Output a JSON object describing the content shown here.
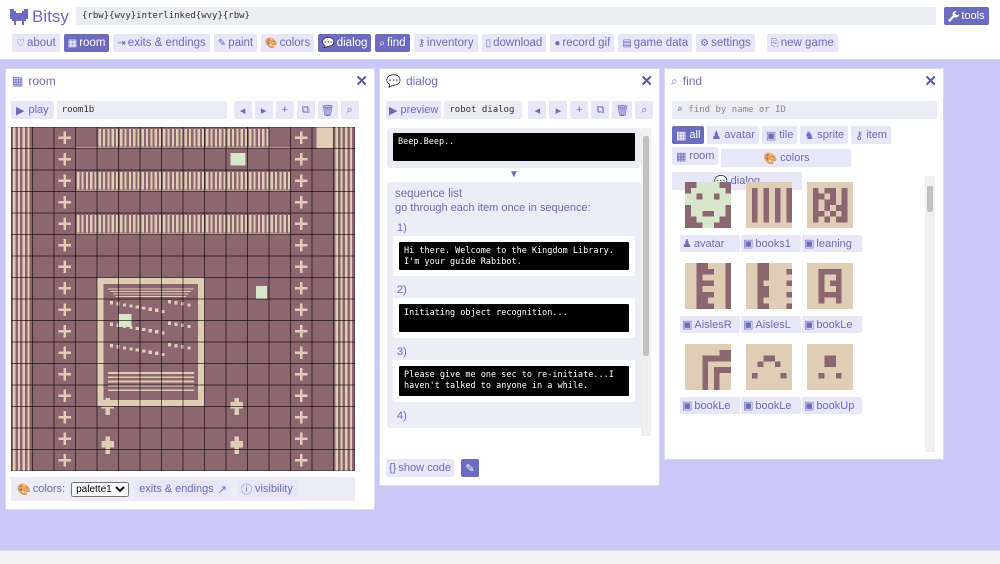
{
  "app": {
    "name": "Bitsy",
    "game_title": "{rbw}{wvy}interlinked{wvy}{rbw}",
    "tools_label": "tools"
  },
  "nav": [
    {
      "id": "about",
      "label": "about",
      "icon": "heart-icon",
      "active": false
    },
    {
      "id": "room",
      "label": "room",
      "icon": "grid-icon",
      "active": true
    },
    {
      "id": "exits",
      "label": "exits & endings",
      "icon": "exit-icon",
      "active": false
    },
    {
      "id": "paint",
      "label": "paint",
      "icon": "brush-icon",
      "active": false
    },
    {
      "id": "colors",
      "label": "colors",
      "icon": "palette-icon",
      "active": false
    },
    {
      "id": "dialog",
      "label": "dialog",
      "icon": "speech-icon",
      "active": true
    },
    {
      "id": "find",
      "label": "find",
      "icon": "search-icon",
      "active": true
    },
    {
      "id": "inventory",
      "label": "inventory",
      "icon": "key-icon",
      "active": false
    },
    {
      "id": "download",
      "label": "download",
      "icon": "file-icon",
      "active": false
    },
    {
      "id": "record",
      "label": "record gif",
      "icon": "record-icon",
      "active": false
    },
    {
      "id": "gamedata",
      "label": "game data",
      "icon": "data-icon",
      "active": false
    },
    {
      "id": "settings",
      "label": "settings",
      "icon": "gear-icon",
      "active": false
    },
    {
      "id": "newgame",
      "label": "new game",
      "icon": "new-file-icon",
      "active": false
    }
  ],
  "room_panel": {
    "title": "room",
    "play_label": "play",
    "room_name": "room1b",
    "colors_label": "colors:",
    "palette_value": "palette1",
    "exits_label": "exits & endings",
    "visibility_label": "visibility"
  },
  "dialog_panel": {
    "title": "dialog",
    "preview_label": "preview",
    "dialog_name": "robot dialog",
    "main_text": "Beep.Beep..",
    "sequence_title": "sequence list",
    "sequence_desc_prefix": "go through each item once in",
    "sequence_desc_link": "sequence:",
    "items": [
      {
        "num": "1)",
        "text": "Hi there. Welcome to the Kingdom Library. I'm your guide Rabibot."
      },
      {
        "num": "2)",
        "text": "Initiating object recognition..."
      },
      {
        "num": "3)",
        "text": "Please give me one sec to re-initiate...I haven't talked to anyone in a while."
      },
      {
        "num": "4)",
        "text": ""
      }
    ],
    "show_code_label": "show code"
  },
  "find_panel": {
    "title": "find",
    "search_placeholder": "find by name or ID",
    "filters": [
      {
        "label": "all",
        "icon": "grid-icon",
        "active": true
      },
      {
        "label": "avatar",
        "icon": "avatar-icon",
        "active": false
      },
      {
        "label": "tile",
        "icon": "tile-icon",
        "active": false
      },
      {
        "label": "sprite",
        "icon": "sprite-icon",
        "active": false
      },
      {
        "label": "item",
        "icon": "key-icon",
        "active": false
      },
      {
        "label": "room",
        "icon": "grid-icon",
        "active": false
      }
    ],
    "filters_row2": [
      {
        "label": "colors",
        "icon": "palette-icon"
      },
      {
        "label": "dialog",
        "icon": "speech-icon"
      }
    ],
    "tiles": [
      {
        "label": "avatar",
        "icon": "avatar-icon"
      },
      {
        "label": "books1",
        "icon": "tile-icon"
      },
      {
        "label": "leaning",
        "icon": "tile-icon"
      },
      {
        "label": "AislesR",
        "icon": "tile-icon"
      },
      {
        "label": "AislesL",
        "icon": "tile-icon"
      },
      {
        "label": "bookLe",
        "icon": "tile-icon"
      },
      {
        "label": "bookLe",
        "icon": "tile-icon"
      },
      {
        "label": "bookLe",
        "icon": "tile-icon"
      },
      {
        "label": "bookUp",
        "icon": "tile-icon"
      }
    ]
  },
  "colors": {
    "accent": "#6b6bbf",
    "room_bg": "#8c6670",
    "room_fg": "#e0cdb5",
    "sprite": "#d8e6c9"
  }
}
